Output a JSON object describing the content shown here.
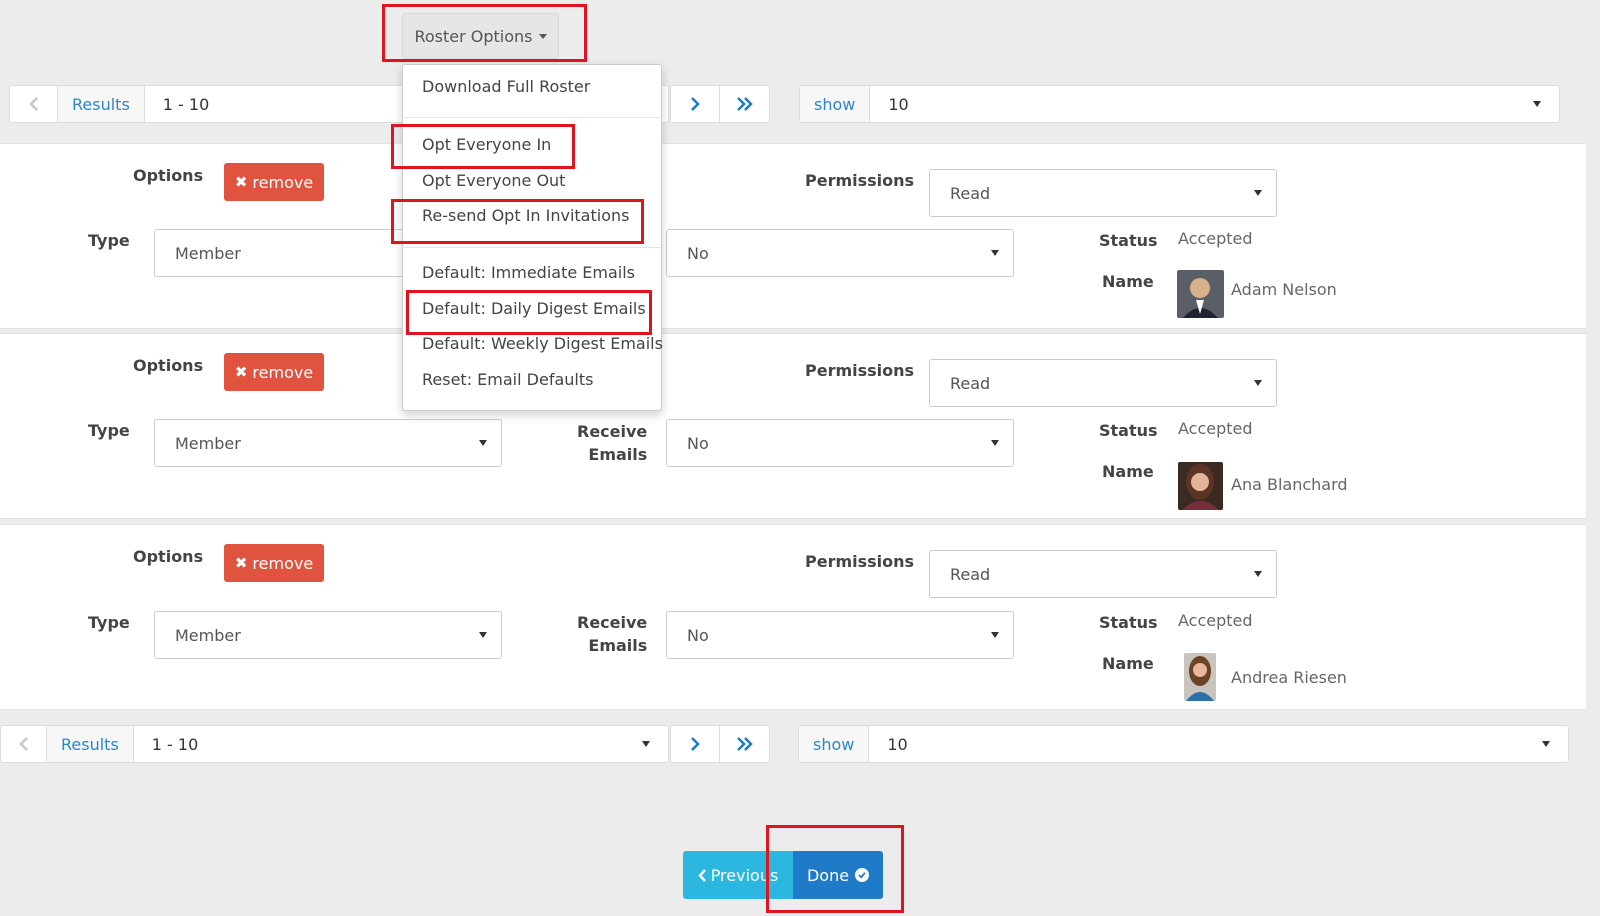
{
  "toolbar": {
    "roster_options_label": "Roster Options"
  },
  "roster_menu": {
    "items": [
      "Download Full Roster",
      "Opt Everyone In",
      "Opt Everyone Out",
      "Re-send Opt In Invitations",
      "Default: Immediate Emails",
      "Default: Daily Digest Emails",
      "Default: Weekly Digest Emails",
      "Reset: Email Defaults"
    ]
  },
  "pager_top": {
    "results_label": "Results",
    "range": "1 - 10",
    "show_label": "show",
    "show_value": "10"
  },
  "pager_bottom": {
    "results_label": "Results",
    "range": "1 - 10",
    "show_label": "show",
    "show_value": "10"
  },
  "labels": {
    "options": "Options",
    "remove": "remove",
    "type": "Type",
    "receive": "Receive",
    "emails": "Emails",
    "permissions": "Permissions",
    "status": "Status",
    "name": "Name"
  },
  "members": [
    {
      "type": "Member",
      "receive_emails": "No",
      "permissions": "Read",
      "status": "Accepted",
      "name": "Adam Nelson"
    },
    {
      "type": "Member",
      "receive_emails": "No",
      "permissions": "Read",
      "status": "Accepted",
      "name": "Ana Blanchard"
    },
    {
      "type": "Member",
      "receive_emails": "No",
      "permissions": "Read",
      "status": "Accepted",
      "name": "Andrea Riesen"
    }
  ],
  "footer": {
    "previous_label": "Previous",
    "done_label": "Done"
  },
  "colors": {
    "accent": "#1f7bc7",
    "danger": "#e0533f",
    "info": "#2bb7e0",
    "highlight": "#e0141e"
  }
}
